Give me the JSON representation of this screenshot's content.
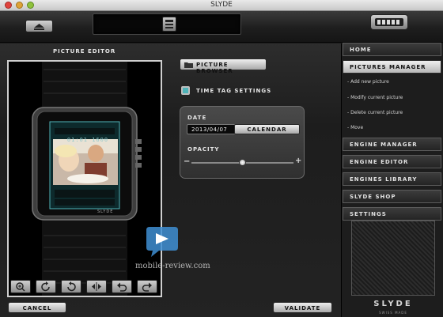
{
  "window": {
    "title": "SLYDE"
  },
  "editor": {
    "title": "PICTURE EDITOR",
    "watch_time": "01:01 1600",
    "watch_brand": "SLYDE",
    "tools": [
      "zoom-in",
      "rotate-left",
      "rotate-right",
      "flip-horizontal",
      "undo",
      "redo"
    ]
  },
  "browser": {
    "button_label": "PICTURE BROWSER"
  },
  "time_tag": {
    "label": "TIME TAG SETTINGS",
    "checked": true
  },
  "date": {
    "label": "DATE",
    "value": "2013/04/07",
    "calendar_label": "CALENDAR"
  },
  "opacity": {
    "label": "OPACITY",
    "minus": "−",
    "plus": "+",
    "value": 0.5
  },
  "actions": {
    "cancel": "CANCEL",
    "validate": "VALIDATE"
  },
  "sidebar": {
    "items": [
      {
        "label": "HOME"
      },
      {
        "label": "PICTURES MANAGER"
      }
    ],
    "subitems": [
      {
        "label": "- Add new picture"
      },
      {
        "label": "- Modify current picture"
      },
      {
        "label": "- Delete current picture"
      },
      {
        "label": "- Move"
      }
    ],
    "lower_items": [
      {
        "label": "ENGINE MANAGER"
      },
      {
        "label": "ENGINE EDITOR"
      },
      {
        "label": "ENGINES LIBRARY"
      },
      {
        "label": "SLYDE SHOP"
      },
      {
        "label": "SETTINGS"
      }
    ],
    "brand": "SLYDE",
    "brand_sub": "SWISS MADE"
  },
  "watermark": {
    "text": "mobile-review.com"
  },
  "colors": {
    "accent_teal": "#4fb3b8",
    "active_nav": "#d9d9d9"
  }
}
